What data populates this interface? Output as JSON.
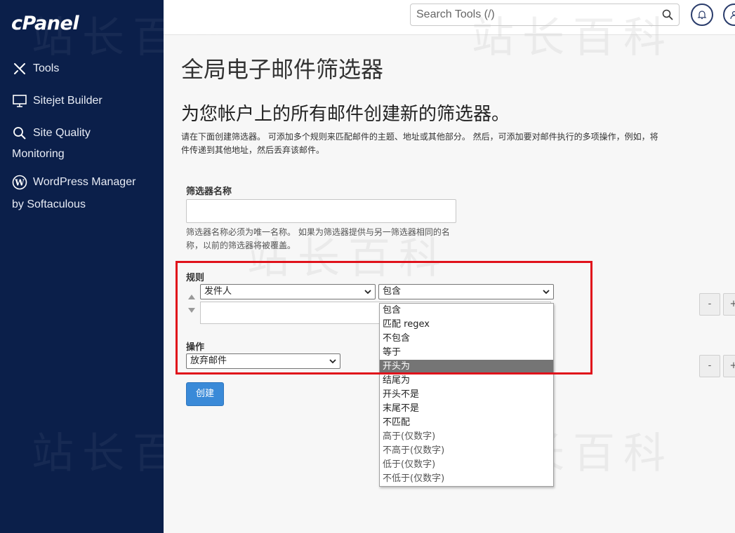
{
  "sidebar": {
    "logo": "cPanel",
    "items": [
      {
        "label": "Tools",
        "icon": "tools-icon"
      },
      {
        "label": "Sitejet Builder",
        "icon": "monitor-icon"
      },
      {
        "label": "Site Quality",
        "label2": "Monitoring",
        "icon": "magnifier-icon"
      },
      {
        "label": "WordPress Manager",
        "label2": "by Softaculous",
        "icon": "wordpress-icon"
      }
    ],
    "bg_color": "#0b1f4a"
  },
  "topbar": {
    "search_placeholder": "Search Tools (/)"
  },
  "page": {
    "title": "全局电子邮件筛选器",
    "subtitle": "为您帐户上的所有邮件创建新的筛选器。",
    "description_line1": "请在下面创建筛选器。 可添加多个规则来匹配邮件的主题、地址或其他部分。 然后，可添加要对邮件执行的多项操作，例如，将",
    "description_line2": "件传递到其他地址，然后丢弃该邮件。"
  },
  "form": {
    "filter_name_label": "筛选器名称",
    "filter_name_value": "",
    "filter_name_help": "筛选器名称必须为唯一名称。 如果为筛选器提供与另一筛选器相同的名称，以前的筛选器将被覆盖。",
    "rules_label": "规则",
    "rule_field_selected": "发件人",
    "rule_op_selected": "包含",
    "rule_value": "",
    "actions_label": "操作",
    "action_selected": "放弃邮件",
    "create_button": "创建",
    "minus_label": "-",
    "plus_label": "+"
  },
  "dropdown_options": [
    "包含",
    "匹配 regex",
    "不包含",
    "等于",
    "开头为",
    "结尾为",
    "开头不是",
    "末尾不是",
    "不匹配",
    "高于(仅数字)",
    "不高于(仅数字)",
    "低于(仅数字)",
    "不低于(仅数字)"
  ],
  "dropdown_highlighted": "开头为",
  "watermark": "站长百科",
  "colors": {
    "accent": "#3a8ad8",
    "highlight_border": "#e0121b",
    "selected_option": "#757575"
  }
}
